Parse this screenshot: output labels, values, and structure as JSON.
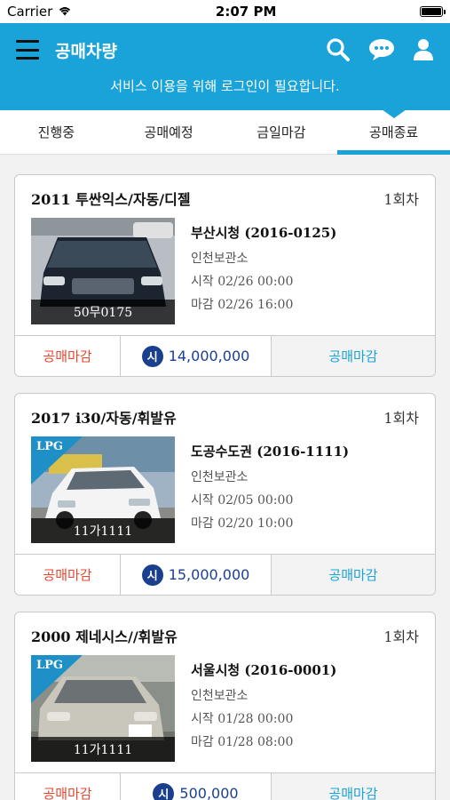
{
  "status_bar": {
    "carrier": "Carrier",
    "time": "2:07 PM"
  },
  "app_bar": {
    "title": "공매차량",
    "login_notice": "서비스 이용을 위해 로그인이 필요합니다."
  },
  "tabs": [
    {
      "label": "진행중",
      "active": false
    },
    {
      "label": "공매예정",
      "active": false
    },
    {
      "label": "금일마감",
      "active": false
    },
    {
      "label": "공매종료",
      "active": true
    }
  ],
  "listings": [
    {
      "title": "2011 투싼익스/자동/디젤",
      "round": "1회차",
      "plate": "50무0175",
      "lpg": false,
      "org": "부산시청 (2016-0125)",
      "location": "인천보관소",
      "start": "시작 02/26 00:00",
      "end": "마감 02/26 16:00",
      "status": "공매마감",
      "price_badge": "시",
      "price": "14,000,000",
      "action": "공매마감",
      "car_color": "#1c2430"
    },
    {
      "title": "2017 i30/자동/휘발유",
      "round": "1회차",
      "plate": "11가1111",
      "lpg": true,
      "lpg_label": "LPG",
      "org": "도공수도권 (2016-1111)",
      "location": "인천보관소",
      "start": "시작 02/05 00:00",
      "end": "마감 02/20 10:00",
      "status": "공매마감",
      "price_badge": "시",
      "price": "15,000,000",
      "action": "공매마감",
      "car_color": "#f4f4f4"
    },
    {
      "title": "2000 제네시스//휘발유",
      "round": "1회차",
      "plate": "11가1111",
      "lpg": true,
      "lpg_label": "LPG",
      "org": "서울시청 (2016-0001)",
      "location": "인천보관소",
      "start": "시작 01/28 00:00",
      "end": "마감 01/28 08:00",
      "status": "공매마감",
      "price_badge": "시",
      "price": "500,000",
      "action": "공매마감",
      "car_color": "#c9c6bc"
    }
  ]
}
